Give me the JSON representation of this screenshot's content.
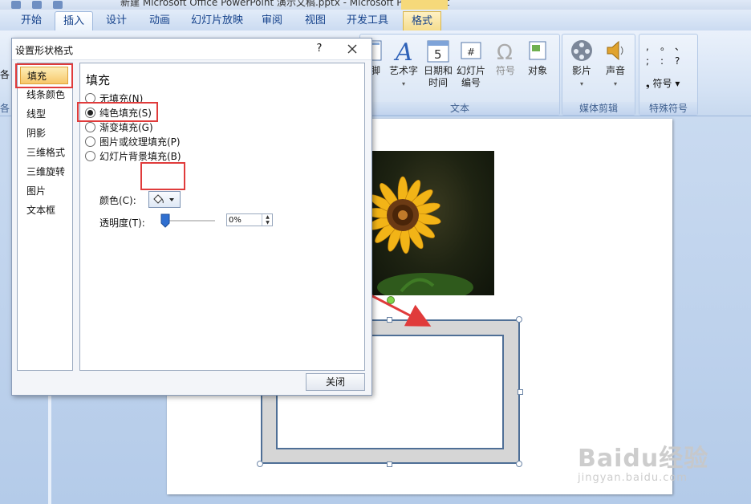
{
  "window": {
    "title_fragment": "新建 Microsoft Office PowerPoint 演示文稿.pptx - Microsoft PowerPoint"
  },
  "ribbon": {
    "tabs": [
      "开始",
      "插入",
      "设计",
      "动画",
      "幻灯片放映",
      "审阅",
      "视图",
      "开发工具",
      "格式"
    ],
    "active_tab": "插入",
    "contextual_tab": "格式",
    "groups": {
      "text": {
        "label": "文本",
        "buttons": {
          "header_footer": "页眉和页脚",
          "header_footer_partial": "脚",
          "wordart": "艺术字",
          "date_time": "日期和时间",
          "slide_number": "幻灯片编号",
          "symbol": "符号",
          "object": "对象"
        }
      },
      "media": {
        "label": "媒体剪辑",
        "buttons": {
          "movie": "影片",
          "sound": "声音"
        }
      },
      "special": {
        "label": "特殊符号",
        "buttons": {
          "symbol": "符号"
        },
        "glyphs": [
          ",",
          "。",
          "、",
          ";",
          ":",
          "?"
        ]
      }
    },
    "left_partial": {
      "top": "各",
      "bottom": "各"
    }
  },
  "dialog": {
    "title": "设置形状格式",
    "help": "?",
    "nav": [
      "填充",
      "线条颜色",
      "线型",
      "阴影",
      "三维格式",
      "三维旋转",
      "图片",
      "文本框"
    ],
    "selected_nav": "填充",
    "panel_title": "填充",
    "fill_options": [
      {
        "label": "无填充(N)",
        "selected": false
      },
      {
        "label": "纯色填充(S)",
        "selected": true
      },
      {
        "label": "渐变填充(G)",
        "selected": false
      },
      {
        "label": "图片或纹理填充(P)",
        "selected": false
      },
      {
        "label": "幻灯片背景填充(B)",
        "selected": false
      }
    ],
    "color_label": "颜色(C):",
    "transparency_label": "透明度(T):",
    "transparency_value": "0%",
    "transparency_fraction": 0,
    "close_button": "关闭"
  },
  "watermark": {
    "brand": "Baidu经验",
    "url": "jingyan.baidu.com"
  },
  "colors": {
    "highlight_red": "#e03b3b",
    "selection_orange": "#f7c76a",
    "shape_border": "#4f6f96"
  }
}
